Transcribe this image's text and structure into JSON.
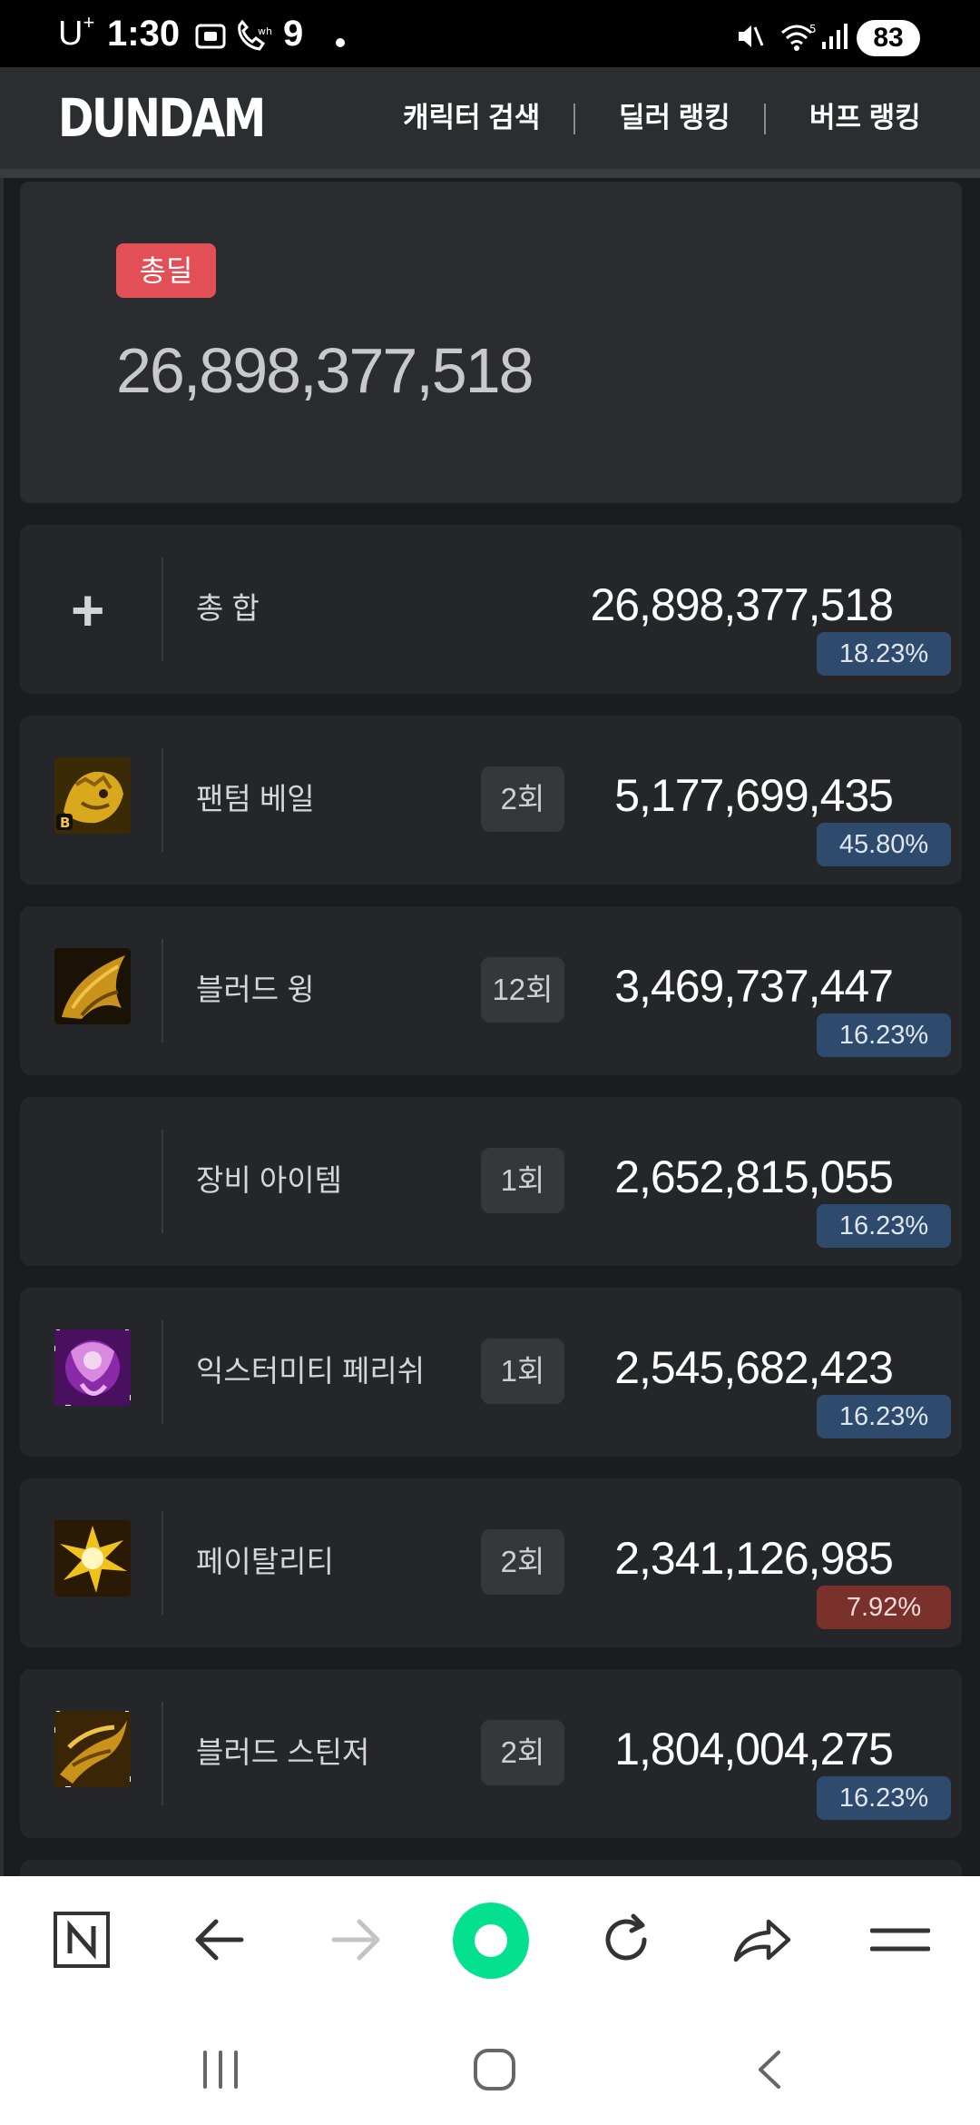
{
  "status_bar": {
    "carrier": "U",
    "carrier_sup": "+",
    "time": "1:30",
    "notification_count": "9",
    "battery": "83"
  },
  "header": {
    "logo": "DUNDAM",
    "nav": [
      "캐릭터 검색",
      "딜러 랭킹",
      "버프 랭킹"
    ]
  },
  "total": {
    "badge": "총딜",
    "value": "26,898,377,518",
    "badge_color": "#e24f57"
  },
  "rows": [
    {
      "icon": "plus-icon",
      "name": "총 합",
      "count": "",
      "damage": "26,898,377,518",
      "percent": "18.23%",
      "percent_color": "blue"
    },
    {
      "icon": "phantom-veil-skill-icon",
      "name": "팬텀 베일",
      "count": "2회",
      "damage": "5,177,699,435",
      "percent": "45.80%",
      "percent_color": "blue"
    },
    {
      "icon": "blood-wing-skill-icon",
      "name": "블러드 윙",
      "count": "12회",
      "damage": "3,469,737,447",
      "percent": "16.23%",
      "percent_color": "blue"
    },
    {
      "icon": "",
      "name": "장비 아이템",
      "count": "1회",
      "damage": "2,652,815,055",
      "percent": "16.23%",
      "percent_color": "blue"
    },
    {
      "icon": "extremity-perish-skill-icon",
      "name": "익스터미티 페리쉬",
      "count": "1회",
      "damage": "2,545,682,423",
      "percent": "16.23%",
      "percent_color": "blue"
    },
    {
      "icon": "fatality-skill-icon",
      "name": "페이탈리티",
      "count": "2회",
      "damage": "2,341,126,985",
      "percent": "7.92%",
      "percent_color": "red"
    },
    {
      "icon": "blood-stinger-skill-icon",
      "name": "블러드 스틴저",
      "count": "2회",
      "damage": "1,804,004,275",
      "percent": "16.23%",
      "percent_color": "blue"
    }
  ],
  "browser_toolbar": [
    "naver-n-icon",
    "back-arrow-icon",
    "forward-arrow-icon",
    "naver-green-circle-icon",
    "refresh-icon",
    "share-icon",
    "menu-icon"
  ],
  "system_nav": [
    "recent-apps-icon",
    "home-icon",
    "back-icon"
  ]
}
